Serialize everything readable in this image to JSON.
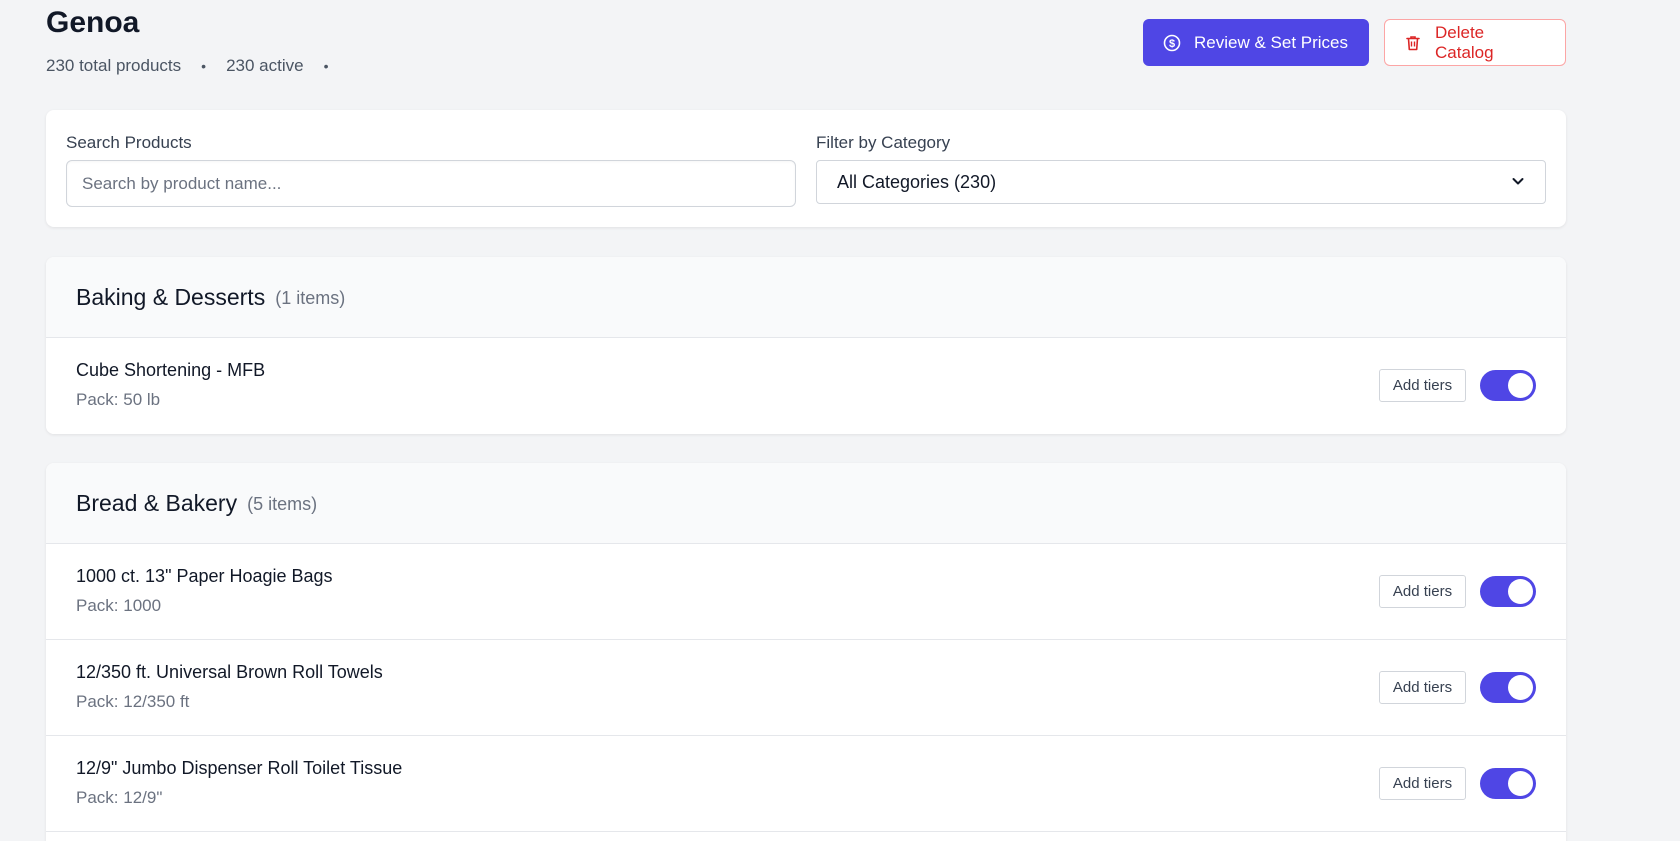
{
  "header": {
    "title": "Genoa",
    "total_products": "230 total products",
    "active": "230 active",
    "separator": "•"
  },
  "actions": {
    "review_label": "Review & Set Prices",
    "delete_label": "Delete Catalog"
  },
  "filters": {
    "search_label": "Search Products",
    "search_placeholder": "Search by product name...",
    "category_label": "Filter by Category",
    "category_selected": "All Categories (230)"
  },
  "colors": {
    "accent": "#4f46e5",
    "danger": "#dc2626"
  },
  "icons": {
    "review": "dollar-circle-icon",
    "delete": "trash-icon",
    "select": "chevron-down-icon"
  },
  "sections": [
    {
      "title": "Baking & Desserts",
      "count": "(1 items)",
      "items": [
        {
          "name": "Cube Shortening - MFB",
          "pack": "Pack: 50 lb",
          "tiers_label": "Add tiers",
          "active": true
        }
      ]
    },
    {
      "title": "Bread & Bakery",
      "count": "(5 items)",
      "items": [
        {
          "name": "1000 ct. 13\" Paper Hoagie Bags",
          "pack": "Pack: 1000",
          "tiers_label": "Add tiers",
          "active": true
        },
        {
          "name": "12/350 ft. Universal Brown Roll Towels",
          "pack": "Pack: 12/350 ft",
          "tiers_label": "Add tiers",
          "active": true
        },
        {
          "name": "12/9\" Jumbo Dispenser Roll Toilet Tissue",
          "pack": "Pack: 12/9\"",
          "tiers_label": "Add tiers",
          "active": true
        }
      ]
    }
  ]
}
